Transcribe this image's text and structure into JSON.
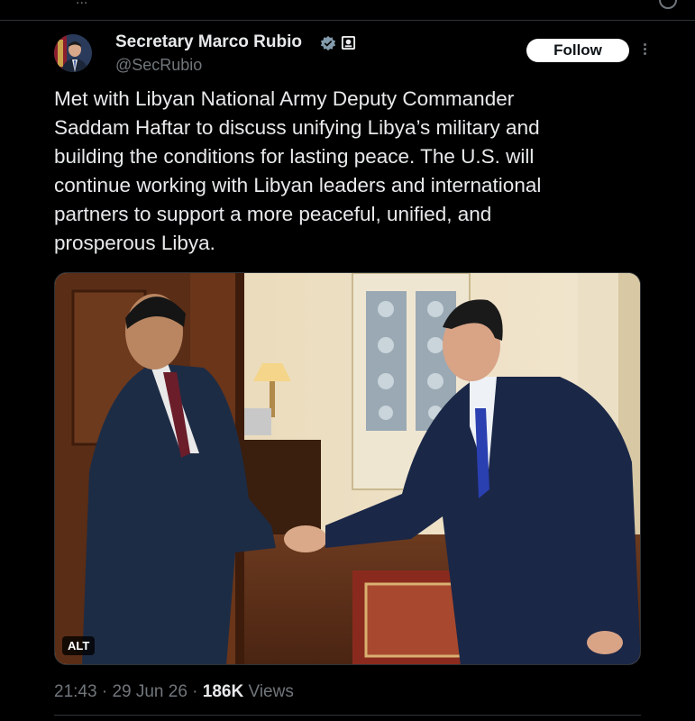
{
  "header": {
    "top_left_text": "...",
    "name": "Secretary Marco Rubio",
    "handle": "@SecRubio",
    "follow_label": "Follow",
    "verified_badge_color": "#829aab"
  },
  "tweet": {
    "text": "Met with Libyan National Army Deputy Commander\nSaddam Haftar to discuss unifying Libya’s military and\nbuilding the conditions for lasting peace. The U.S. will\ncontinue working with Libyan leaders and international\npartners to support a more peaceful, unified, and\nprosperous Libya.",
    "media_alt_label": "ALT"
  },
  "meta": {
    "time": "21:43",
    "sep1": " · ",
    "date": "29 Jun 26",
    "sep2": " · ",
    "views_count": "186K",
    "views_label": " Views"
  },
  "colors": {
    "background": "#000000",
    "text_primary": "#e7e9ea",
    "text_secondary": "#71767b",
    "divider": "#2f3336"
  }
}
